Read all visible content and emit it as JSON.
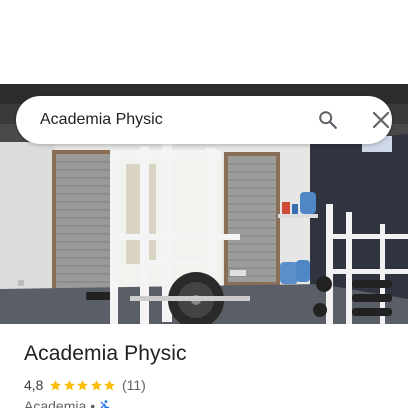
{
  "search": {
    "query": "Academia Physic"
  },
  "place": {
    "name": "Academia Physic",
    "rating": "4,8",
    "stars": 5,
    "review_count": "(11)",
    "category": "Academia",
    "separator": "•"
  },
  "icons": {
    "search": "search-icon",
    "close": "close-icon",
    "star": "star-icon",
    "accessibility": "wheelchair-icon"
  },
  "colors": {
    "star": "#fbbc04",
    "accessibility": "#1a73e8",
    "text_primary": "#202124",
    "text_secondary": "#5f6368"
  }
}
